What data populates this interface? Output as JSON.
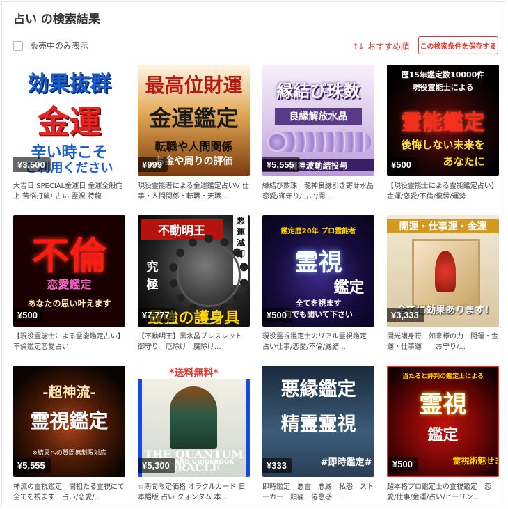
{
  "page": {
    "title": "占い の検索結果",
    "filter_label": "販売中のみ表示",
    "sort_icon": "↑↓",
    "sort_label": "おすすめ順",
    "save_button": "この検索条件を保存する",
    "accent_color": "#e0392f"
  },
  "items": [
    {
      "lines": [
        "効果抜群",
        "金運",
        "辛い時こそ",
        "ご利用ください"
      ],
      "price": "¥3,500",
      "description": "大吉日 SPECIAL金運日 金運全般向上 苦悩打破! 占い 霊視 特龍"
    },
    {
      "lines": [
        "最高位財運",
        "金運鑑定",
        "転職や人間関係",
        "お金や周りの評価"
      ],
      "price": "¥999",
      "description": "現役霊能者による金運鑑定占いV 仕事・人間関係・転職・天職..."
    },
    {
      "lines": [
        "縁結び珠数",
        "良縁解放水晶",
        "",
        "龍神波動結投与"
      ],
      "price": "¥5,555",
      "description": "縁結び数珠　龍神良縁引き寄せ水晶　恋愛/御守り/占い/開..."
    },
    {
      "lines": [
        "歴15年鑑定数10000件",
        "現役霊能士による",
        "霊能鑑定",
        "後悔しない未来を",
        "あなたに"
      ],
      "price": "¥500",
      "description": "【現役霊能士による霊能鑑定占い】 金運/恋愛/不倫/復縁/運勢"
    },
    {
      "lines": [
        "不倫",
        "恋愛鑑定",
        "あなたの思い叶えます"
      ],
      "price": "¥500",
      "description": "【現役霊能士による霊能鑑定占い】 不倫鑑定恋愛占い"
    },
    {
      "lines": [
        "不動明王",
        "悪運滅却",
        "究極",
        "最強の護身具"
      ],
      "price": "¥7,777",
      "description": "【不動明王】黒水晶ブレスレット　御守り　厄除け　魔除け..."
    },
    {
      "lines": [
        "鑑定歴20年 プロ霊能者",
        "霊視",
        "鑑定",
        "全てを視ます",
        "何でも聞いて下さい"
      ],
      "price": "¥500",
      "description": "現役霊視鑑定士のリアル霊視鑑定　占い仕事/恋愛/不倫/縁結..."
    },
    {
      "lines": [
        "開運・仕事運・金運",
        "全てに効果あります!"
      ],
      "price": "¥3,333",
      "description": "開光護身符　如来様の力　開運・金運・仕事運　　お守り/..."
    },
    {
      "lines": [
        "-超神流-",
        "霊視鑑定",
        "※結果への質問無制限対応"
      ],
      "price": "¥5,555",
      "description": "神流の霊視鑑定　開祖たる霊視にて全てを視ます　占い/恋愛/..."
    },
    {
      "lines": [
        "*送料無料*",
        "THE QUANTUM ORACLE",
        "DECK AND GUIDEBOOK"
      ],
      "price": "¥5,300",
      "description": "☆期間限定価格 オラクルカード 日本語版 占い クォンタム 本..."
    },
    {
      "lines": [
        "悪縁鑑定",
        "精霊霊視",
        "#即時鑑定#"
      ],
      "price": "¥333",
      "description": "即時鑑定　悪霊　悪縁　私怨　ストーカー　頭痛　倦怠感　..."
    },
    {
      "lines": [
        "当たると評判の鑑定士による",
        "霊視",
        "鑑定",
        "霊視術魅せます"
      ],
      "price": "¥500",
      "description": "超本格プロ鑑定士の霊視鑑定　恋愛/仕事/金運/占い/ヒーリン..."
    }
  ]
}
